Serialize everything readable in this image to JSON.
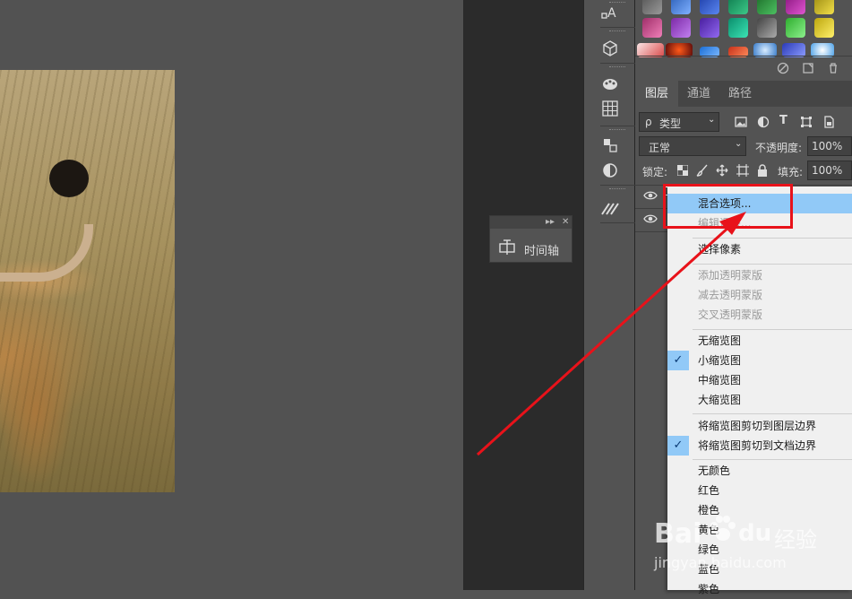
{
  "timeline_panel": {
    "label": "时间轴",
    "expand_glyph": "▸▸",
    "close_glyph": "✕"
  },
  "layers_panel": {
    "tabs": [
      {
        "label": "图层"
      },
      {
        "label": "通道"
      },
      {
        "label": "路径"
      }
    ],
    "filter": {
      "prefix": "ρ",
      "value": "类型"
    },
    "blend_mode": "正常",
    "opacity_label": "不透明度:",
    "opacity_value": "100%",
    "lock_label": "锁定:",
    "fill_label": "填充:",
    "fill_value": "100%",
    "filter_icons": [
      "image-filter-icon",
      "adjustment-filter-icon",
      "type-filter-icon",
      "shape-filter-icon",
      "smart-object-filter-icon"
    ],
    "lock_icons": [
      "lock-transparent-icon",
      "lock-paint-icon",
      "lock-position-icon",
      "lock-artboard-icon",
      "lock-all-icon"
    ]
  },
  "toolstrip_icons": [
    "character-icon",
    "3d-cube-icon",
    "palette-icon",
    "grid-icon",
    "adjustments-icon",
    "half-circle-icon",
    "brush-strokes-icon"
  ],
  "context_menu": {
    "groups": [
      [
        {
          "label": "混合选项...",
          "enabled": true,
          "highlighted": true
        },
        {
          "label": "编辑调整...",
          "enabled": false
        }
      ],
      [
        {
          "label": "选择像素",
          "enabled": true
        }
      ],
      [
        {
          "label": "添加透明蒙版",
          "enabled": false
        },
        {
          "label": "减去透明蒙版",
          "enabled": false
        },
        {
          "label": "交叉透明蒙版",
          "enabled": false
        }
      ],
      [
        {
          "label": "无缩览图",
          "enabled": true
        },
        {
          "label": "小缩览图",
          "enabled": true,
          "checked": true
        },
        {
          "label": "中缩览图",
          "enabled": true
        },
        {
          "label": "大缩览图",
          "enabled": true
        }
      ],
      [
        {
          "label": "将缩览图剪切到图层边界",
          "enabled": true
        },
        {
          "label": "将缩览图剪切到文档边界",
          "enabled": true,
          "checked": true
        }
      ],
      [
        {
          "label": "无颜色",
          "enabled": true
        },
        {
          "label": "红色",
          "enabled": true
        },
        {
          "label": "橙色",
          "enabled": true
        },
        {
          "label": "黄色",
          "enabled": true
        },
        {
          "label": "绿色",
          "enabled": true
        },
        {
          "label": "蓝色",
          "enabled": true
        },
        {
          "label": "紫色",
          "enabled": true
        }
      ]
    ],
    "check_glyph": "✓"
  },
  "watermark": {
    "brand": "Bai",
    "brand_suffix": "du",
    "cn": "经验",
    "url": "jingyan.baidu.com"
  },
  "colors": {
    "annotation_red": "#e8121a",
    "menu_highlight": "#91c9f7",
    "menu_bg": "#f0f0f0",
    "panel_bg": "#535353",
    "dark_bg": "#2b2b2b"
  }
}
